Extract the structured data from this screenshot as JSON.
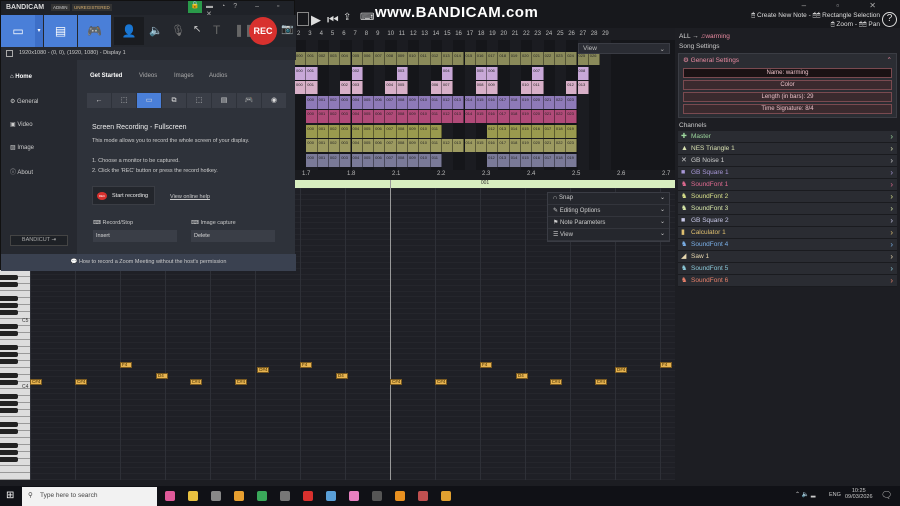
{
  "bandicam": {
    "logo": "BANDICAM",
    "badge_admin": "ADMIN",
    "badge_unreg": "UNREGISTERED",
    "rec": "REC",
    "display": "1920x1080 - (0, 0), (1920, 1080) - Display 1",
    "sidebar": [
      "Home",
      "General",
      "Video",
      "Image",
      "About"
    ],
    "tabs": [
      "Get Started",
      "Videos",
      "Images",
      "Audios"
    ],
    "heading": "Screen Recording - Fullscreen",
    "desc": "This mode allows you to record the whole screen of your display.",
    "step1": "1. Choose a monitor to be captured.",
    "step2": "2. Click the 'REC' button or press the record hotkey.",
    "start_rec": "Start recording",
    "rec_badge": "REC",
    "help_link": "View online help",
    "hk_record_label": "Record/Stop",
    "hk_record_value": "Insert",
    "hk_image_label": "Image capture",
    "hk_image_value": "Delete",
    "bandicut": "BANDICUT ⇥",
    "footer": "How to record a Zoom Meeting without the host's permission"
  },
  "watermark": "www.BANDICAM.com",
  "hints": {
    "line1": "🖱 Create New Note - 🖱🖱 Rectangle Selection",
    "line2": "🖱 Zoom - 🖱🖱 Pan"
  },
  "measures": [
    "2",
    "3",
    "4",
    "5",
    "6",
    "7",
    "8",
    "9",
    "10",
    "11",
    "12",
    "13",
    "14",
    "15",
    "16",
    "17",
    "18",
    "19",
    "20",
    "21",
    "22",
    "23",
    "24",
    "25",
    "26",
    "27",
    "28",
    "29"
  ],
  "track_rows": [
    {
      "color": "#8a8a5a",
      "measures": [
        2,
        3,
        4,
        5,
        6,
        7,
        8,
        9,
        10,
        11,
        12,
        13,
        14,
        15,
        16,
        17,
        18,
        19,
        20,
        21,
        22,
        23,
        24,
        25,
        26,
        27,
        28
      ]
    },
    {
      "color": "#c8a8d8",
      "measures": [
        2,
        3,
        7,
        11,
        15,
        18,
        19,
        23,
        27
      ]
    },
    {
      "color": "#d8b0c8",
      "measures": [
        2,
        3,
        6,
        7,
        10,
        11,
        14,
        15,
        18,
        19,
        22,
        23,
        26,
        27
      ]
    },
    {
      "color": "#8e7ab8",
      "measures": [
        3,
        4,
        5,
        6,
        7,
        8,
        9,
        10,
        11,
        12,
        13,
        14,
        15,
        16,
        17,
        18,
        19,
        20,
        21,
        22,
        23,
        24,
        25,
        26
      ]
    },
    {
      "color": "#b04a78",
      "measures": [
        3,
        4,
        5,
        6,
        7,
        8,
        9,
        10,
        11,
        12,
        13,
        14,
        15,
        16,
        17,
        18,
        19,
        20,
        21,
        22,
        23,
        24,
        25,
        26
      ]
    },
    {
      "color": "#9a9a4e",
      "measures": [
        3,
        4,
        5,
        6,
        7,
        8,
        9,
        10,
        11,
        12,
        13,
        14,
        19,
        20,
        21,
        22,
        23,
        24,
        25,
        26
      ]
    },
    {
      "color": "#9c9a60",
      "measures": [
        3,
        4,
        5,
        6,
        7,
        8,
        9,
        10,
        11,
        12,
        13,
        14,
        15,
        16,
        17,
        18,
        19,
        20,
        21,
        22,
        23,
        24,
        25,
        26
      ]
    },
    {
      "color": "#7a7a98",
      "measures": [
        3,
        4,
        5,
        6,
        7,
        8,
        9,
        10,
        11,
        12,
        13,
        14,
        19,
        20,
        21,
        22,
        23,
        24,
        25,
        26
      ]
    }
  ],
  "ruler": [
    "1.7",
    "1.8",
    "2.1",
    "2.2",
    "2.3",
    "2.4",
    "2.5",
    "2.6",
    "2.7"
  ],
  "loop_label": "001",
  "view_label": "View",
  "roll_options": [
    "Snap",
    "Editing Options",
    "Note Parameters",
    "View"
  ],
  "keys": {
    "c5": "C5",
    "c4": "C4"
  },
  "notes": [
    {
      "label": "C#4",
      "midi": 61,
      "beat": 0
    },
    {
      "label": "C#4",
      "midi": 61,
      "beat": 1
    },
    {
      "label": "F4",
      "midi": 65,
      "beat": 2
    },
    {
      "label": "D4",
      "midi": 62,
      "beat": 2.8
    },
    {
      "label": "C#4",
      "midi": 61,
      "beat": 3.55
    },
    {
      "label": "C#4",
      "midi": 61,
      "beat": 4.55
    },
    {
      "label": "D#4",
      "midi": 63,
      "beat": 5.05
    },
    {
      "label": "F4",
      "midi": 65,
      "beat": 6
    },
    {
      "label": "D4",
      "midi": 62,
      "beat": 6.8
    },
    {
      "label": "C#4",
      "midi": 61,
      "beat": 8
    },
    {
      "label": "C#4",
      "midi": 61,
      "beat": 9
    },
    {
      "label": "F4",
      "midi": 65,
      "beat": 10
    },
    {
      "label": "D4",
      "midi": 62,
      "beat": 10.8
    },
    {
      "label": "C#4",
      "midi": 61,
      "beat": 11.55
    },
    {
      "label": "C#4",
      "midi": 61,
      "beat": 12.55
    },
    {
      "label": "D#4",
      "midi": 63,
      "beat": 13
    },
    {
      "label": "F4",
      "midi": 65,
      "beat": 14
    }
  ],
  "right": {
    "breadcrumb_all": "ALL →",
    "breadcrumb_song": "♫warming",
    "song_settings": "Song Settings",
    "general": "General Settings",
    "name": "Name: warming",
    "color": "Color",
    "length": "Length (in bars): 29",
    "timesig": "Time Signature: 8/4",
    "channels_title": "Channels",
    "channels": [
      {
        "name": "Master",
        "color": "#9ed89e",
        "icon": "✚"
      },
      {
        "name": "NES Triangle 1",
        "color": "#d8e0b0",
        "icon": "▲"
      },
      {
        "name": "GB Noise 1",
        "color": "#cccccc",
        "icon": "✕"
      },
      {
        "name": "GB Square 1",
        "color": "#a898d8",
        "icon": "■"
      },
      {
        "name": "SoundFont 1",
        "color": "#e06a90",
        "icon": "♞"
      },
      {
        "name": "SoundFont 2",
        "color": "#d8e08a",
        "icon": "♞"
      },
      {
        "name": "SoundFont 3",
        "color": "#d8e8a8",
        "icon": "♞"
      },
      {
        "name": "GB Square 2",
        "color": "#c8c8e8",
        "icon": "■"
      },
      {
        "name": "Calculator 1",
        "color": "#e0c070",
        "icon": "▮"
      },
      {
        "name": "SoundFont 4",
        "color": "#7ab0e8",
        "icon": "♞"
      },
      {
        "name": "Saw 1",
        "color": "#e8d8b0",
        "icon": "◢"
      },
      {
        "name": "SoundFont 5",
        "color": "#8ac8d8",
        "icon": "♞"
      },
      {
        "name": "SoundFont 6",
        "color": "#e8806a",
        "icon": "♞"
      }
    ]
  },
  "taskbar": {
    "search": "Type here to search",
    "time": "10:25",
    "date": "09/03/2026",
    "lang": "ENG"
  }
}
